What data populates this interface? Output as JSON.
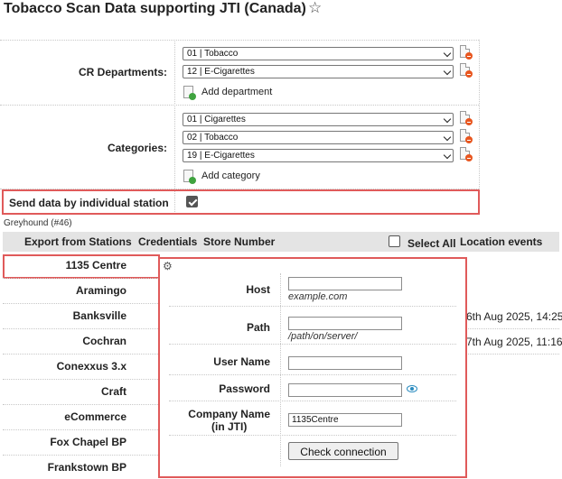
{
  "page": {
    "title": "Tobacco Scan Data supporting JTI (Canada)",
    "favorite_icon": "star-outline-icon"
  },
  "cr_departments": {
    "label": "CR Departments:",
    "selected": [
      "01 | Tobacco",
      "12 | E-Cigarettes"
    ],
    "add_label": "Add department"
  },
  "categories": {
    "label": "Categories:",
    "selected": [
      "01 | Cigarettes",
      "02 | Tobacco",
      "19 | E-Cigarettes"
    ],
    "add_label": "Add category"
  },
  "send_by_station": {
    "label": "Send data by individual station",
    "checked": true
  },
  "group": {
    "name": "Greyhound (#46)"
  },
  "table": {
    "headers": {
      "export": "Export from Stations",
      "credentials": "Credentials",
      "store_number": "Store Number",
      "select_all": "Select All",
      "location_events": "Location events"
    },
    "stations": [
      "1135 Centre",
      "Aramingo",
      "Banksville",
      "Cochran",
      "Conexxus 3.x",
      "Craft",
      "eCommerce",
      "Fox Chapel BP",
      "Frankstown BP"
    ],
    "location_events_partial": {
      "banksville": "6th Aug 2025, 14:25",
      "cochran": "7th Aug 2025, 11:16"
    }
  },
  "credentials_popup": {
    "gear_icon": "gear-icon",
    "host": {
      "label": "Host",
      "value": "",
      "hint": "example.com"
    },
    "path": {
      "label": "Path",
      "value": "",
      "hint": "/path/on/server/"
    },
    "user_name": {
      "label": "User Name",
      "value": ""
    },
    "password": {
      "label": "Password",
      "value": "",
      "reveal_icon": "eye-icon"
    },
    "company_name": {
      "label_line1": "Company Name",
      "label_line2": "(in JTI)",
      "value": "1135Centre"
    },
    "check_button": "Check connection"
  },
  "colors": {
    "highlight_border": "#e05a5a",
    "header_bg": "#e4e4e4",
    "eye_icon": "#2a8bbf",
    "remove_icon": "#e8561f",
    "add_icon": "#3fa33f"
  }
}
